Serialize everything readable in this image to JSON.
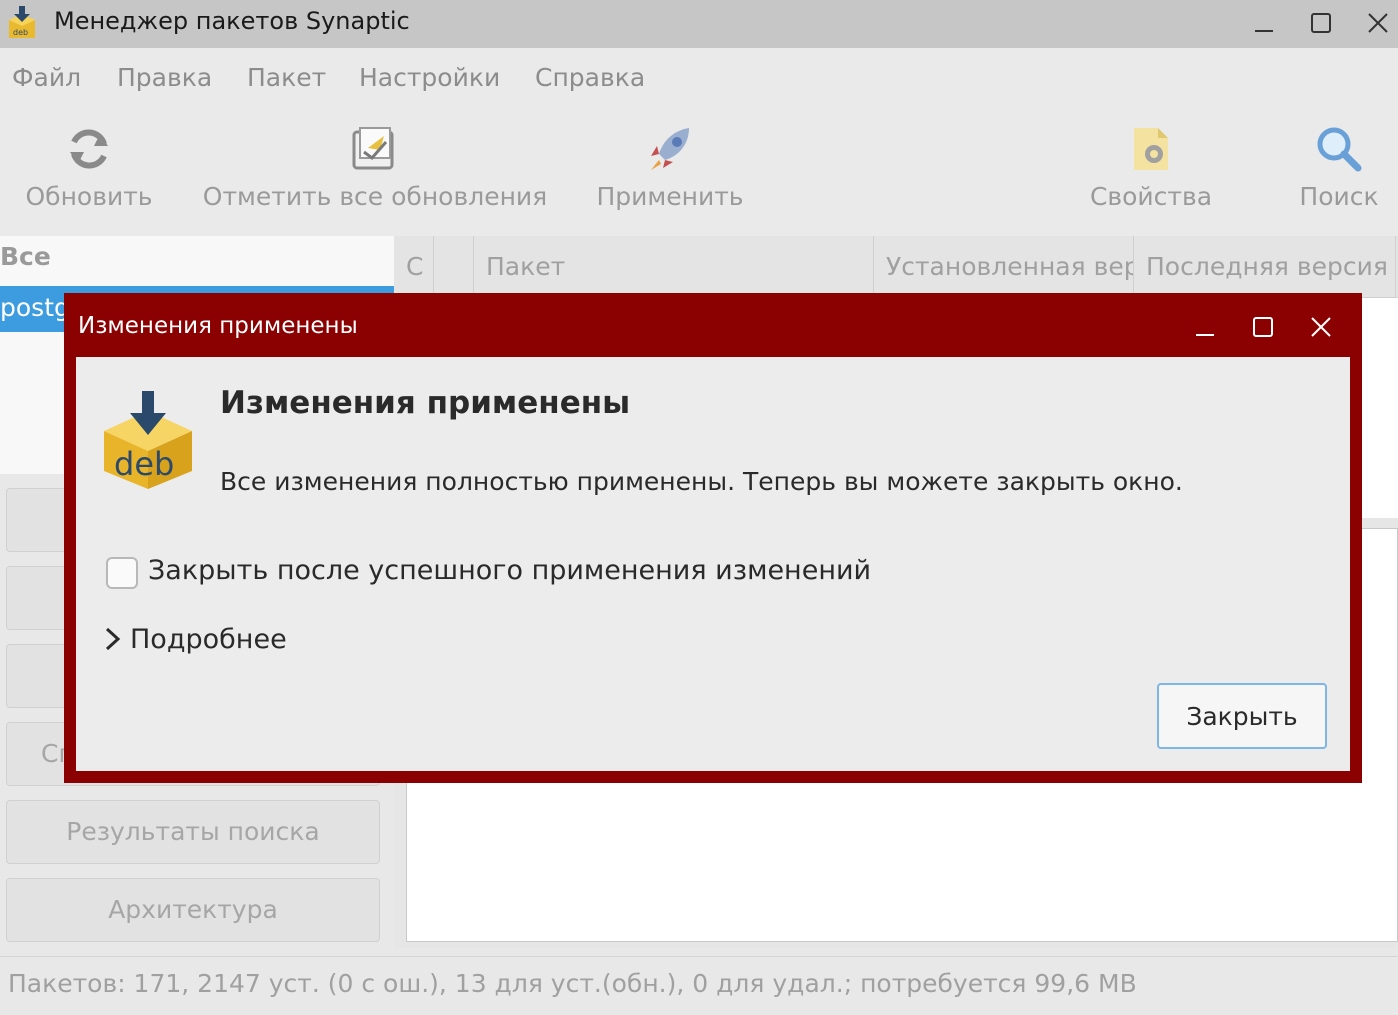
{
  "window": {
    "title": "Менеджер пакетов Synaptic"
  },
  "menubar": {
    "items": [
      "Файл",
      "Правка",
      "Пакет",
      "Настройки",
      "Справка"
    ]
  },
  "toolbar": {
    "reload": "Обновить",
    "mark_all": "Отметить все обновления",
    "apply": "Применить",
    "properties": "Свойства",
    "search": "Поиск"
  },
  "left_pane": {
    "header": "Все",
    "selected_item": "postg",
    "buttons": [
      "",
      "",
      "",
      "Сг",
      "Результаты поиска",
      "Архитектура"
    ]
  },
  "table": {
    "columns": [
      "С",
      "",
      "Пакет",
      "Установленная вер",
      "Последняя версия"
    ]
  },
  "statusbar": {
    "text": "Пакетов: 171, 2147 уст. (0 с ош.), 13 для уст.(обн.), 0 для удал.; потребуется 99,6 MB"
  },
  "dialog": {
    "title": "Изменения применены",
    "heading": "Изменения применены",
    "message": "Все изменения полностью применены. Теперь вы можете закрыть окно.",
    "checkbox_label": "Закрыть после успешного применения изменений",
    "checkbox_checked": false,
    "expander_label": "Подробнее",
    "close_button": "Закрыть",
    "icon_text": "deb"
  },
  "colors": {
    "dialog_border": "#8b0000",
    "selection": "#3d9be0",
    "button_focus": "#7fb5e6"
  }
}
